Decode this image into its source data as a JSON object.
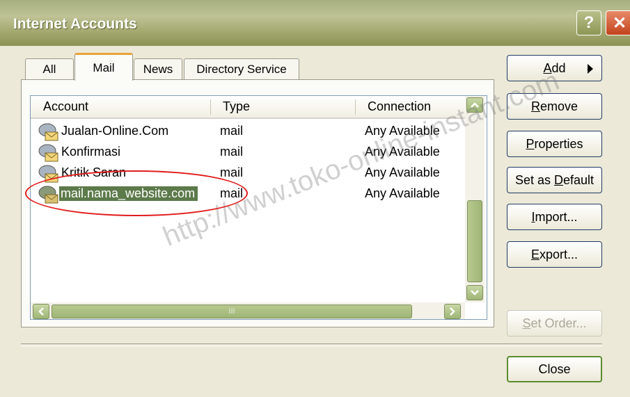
{
  "window": {
    "title": "Internet Accounts",
    "help_glyph": "?",
    "close_glyph": "✕"
  },
  "tabs": [
    {
      "label": "All"
    },
    {
      "label": "Mail"
    },
    {
      "label": "News"
    },
    {
      "label": "Directory Service"
    }
  ],
  "list": {
    "columns": [
      "Account",
      "Type",
      "Connection"
    ],
    "rows": [
      {
        "account": "Jualan-Online.Com",
        "type": "mail",
        "connection": "Any Available"
      },
      {
        "account": "Konfirmasi",
        "type": "mail",
        "connection": "Any Available"
      },
      {
        "account": "Kritik Saran",
        "type": "mail",
        "connection": "Any Available"
      },
      {
        "account": "mail.nama_website.com",
        "type": "mail",
        "connection": "Any Available",
        "selected": true
      }
    ],
    "hscroll_grip": "III"
  },
  "buttons": {
    "add": {
      "pre": "",
      "key": "A",
      "post": "dd"
    },
    "remove": {
      "pre": "",
      "key": "R",
      "post": "emove"
    },
    "properties": {
      "pre": "",
      "key": "P",
      "post": "roperties"
    },
    "set_default": {
      "pre": "Set as ",
      "key": "D",
      "post": "efault"
    },
    "import": {
      "pre": "",
      "key": "I",
      "post": "mport..."
    },
    "export": {
      "pre": "",
      "key": "E",
      "post": "xport..."
    },
    "set_order": {
      "pre": "",
      "key": "S",
      "post": "et Order..."
    },
    "close": {
      "label": "Close"
    }
  },
  "watermark": "http://www.toko-online-instant.com",
  "colors": {
    "title_bar": "#a6ae7e",
    "selection": "#5c7a4a",
    "annotation_ellipse": "#e21b1b"
  }
}
